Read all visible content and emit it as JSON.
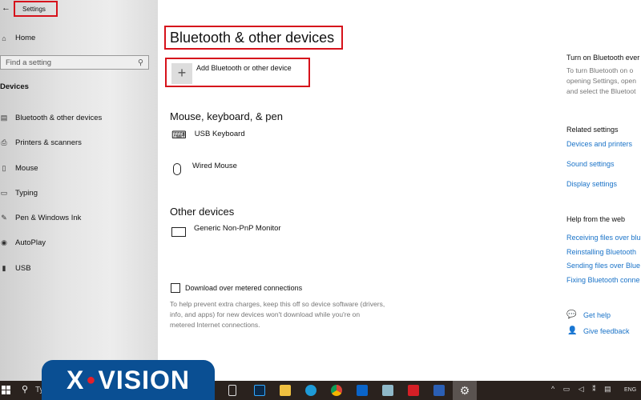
{
  "window": {
    "title": "Settings"
  },
  "sidebar": {
    "home": "Home",
    "search_placeholder": "Find a setting",
    "section": "Devices",
    "items": [
      {
        "label": "Bluetooth & other devices",
        "icon": "bluetooth-devices-icon"
      },
      {
        "label": "Printers & scanners",
        "icon": "printer-icon"
      },
      {
        "label": "Mouse",
        "icon": "mouse-icon"
      },
      {
        "label": "Typing",
        "icon": "keyboard-icon"
      },
      {
        "label": "Pen & Windows Ink",
        "icon": "pen-icon"
      },
      {
        "label": "AutoPlay",
        "icon": "autoplay-icon"
      },
      {
        "label": "USB",
        "icon": "usb-icon"
      }
    ]
  },
  "main": {
    "title": "Bluetooth & other devices",
    "add_device": "Add Bluetooth or other device",
    "mouse_section": "Mouse, keyboard, & pen",
    "devices": [
      "USB Keyboard",
      "Wired Mouse"
    ],
    "other_section": "Other devices",
    "other_devices": [
      "Generic Non-PnP Monitor"
    ],
    "metered_label": "Download over metered connections",
    "metered_checked": false,
    "metered_desc": [
      "To help prevent extra charges, keep this off so device software (drivers,",
      "info, and apps) for new devices won't download while you're on",
      "metered Internet connections."
    ]
  },
  "right": {
    "turn_on_title": "Turn on Bluetooth ever",
    "turn_on_desc": [
      "To turn Bluetooth on o",
      "opening Settings, open",
      "and select the Bluetoot"
    ],
    "related_title": "Related settings",
    "related": [
      "Devices and printers",
      "Sound settings",
      "Display settings"
    ],
    "help_title": "Help from the web",
    "help_links": [
      "Receiving files over blu",
      "Reinstalling Bluetooth",
      "Sending files over Blue",
      "Fixing Bluetooth conne"
    ],
    "get_help": "Get help",
    "give_feedback": "Give feedback"
  },
  "taskbar": {
    "search_text": "Ty",
    "language": "ENG"
  },
  "watermark": {
    "text": "X·VISION"
  },
  "colors": {
    "accent": "#1a73c8",
    "highlight": "#d6121b",
    "logo": "#0a4f93"
  }
}
